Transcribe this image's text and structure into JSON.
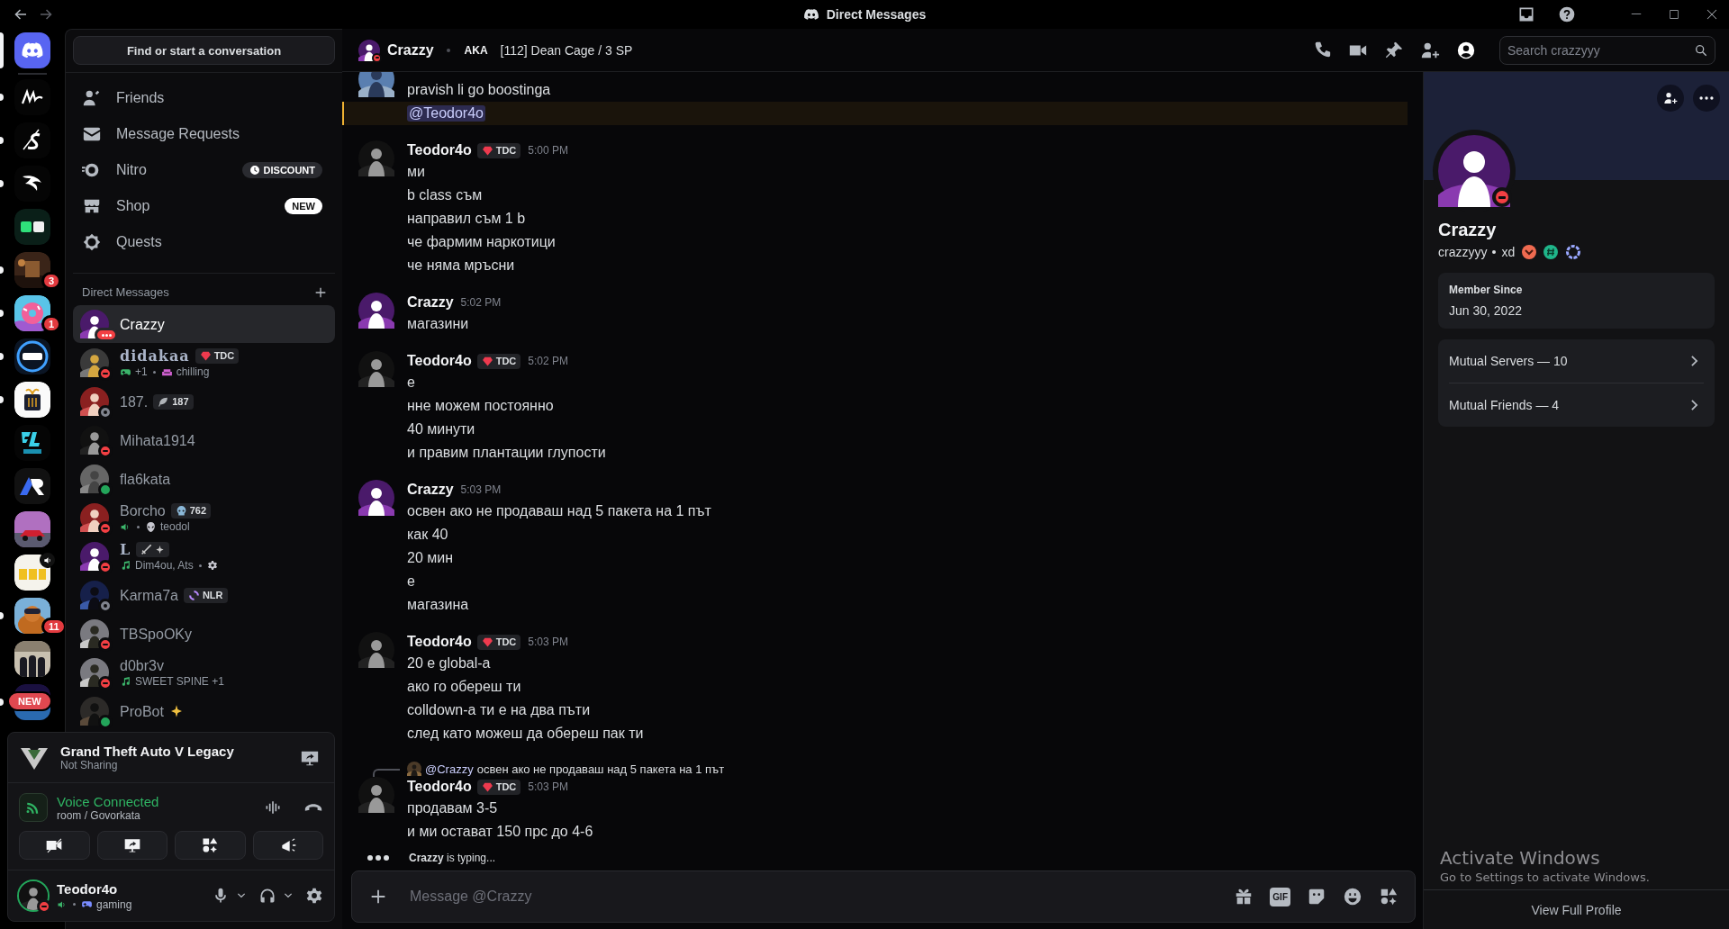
{
  "titlebar": {
    "title": "Direct Messages"
  },
  "servers": [
    {
      "kind": "home",
      "selected": true,
      "unread": false
    },
    {
      "kind": "logo",
      "selected": false,
      "unread": true
    },
    {
      "kind": "logo",
      "selected": false,
      "unread": true
    },
    {
      "kind": "logo",
      "selected": false,
      "unread": true
    },
    {
      "kind": "logo",
      "selected": false,
      "unread": false
    },
    {
      "kind": "picture",
      "selected": false,
      "unread": true,
      "badge": "3"
    },
    {
      "kind": "picture",
      "selected": false,
      "unread": true,
      "badge": "1"
    },
    {
      "kind": "logo",
      "selected": false,
      "unread": true
    },
    {
      "kind": "logo",
      "selected": false,
      "unread": true
    },
    {
      "kind": "logo",
      "selected": false,
      "unread": false
    },
    {
      "kind": "logo",
      "selected": false,
      "unread": false
    },
    {
      "kind": "picture",
      "selected": false,
      "unread": false
    },
    {
      "kind": "logo",
      "selected": false,
      "unread": false,
      "voice": true
    },
    {
      "kind": "picture",
      "selected": false,
      "unread": true,
      "badge": "11"
    },
    {
      "kind": "picture",
      "selected": false,
      "unread": false
    },
    {
      "kind": "picture",
      "selected": false,
      "unread": true,
      "new_label": "NEW"
    }
  ],
  "find_button": "Find or start a conversation",
  "nav": [
    {
      "kind": "friends",
      "label": "Friends",
      "selected": false
    },
    {
      "kind": "mail",
      "label": "Message Requests",
      "selected": false
    },
    {
      "kind": "nitro",
      "label": "Nitro",
      "selected": false,
      "badge": {
        "kind": "discount",
        "text": "DISCOUNT"
      }
    },
    {
      "kind": "shop",
      "label": "Shop",
      "selected": false,
      "badge": {
        "kind": "new",
        "text": "NEW"
      }
    },
    {
      "kind": "quests",
      "label": "Quests",
      "selected": false
    }
  ],
  "dm_heading": "Direct Messages",
  "dms": [
    {
      "name": "Crazzy",
      "presence": {
        "kind": "typing",
        "color": "#f23f43"
      },
      "selected": true
    },
    {
      "name": "didakaa",
      "presence": {
        "kind": "dnd",
        "color": "#f23f43"
      },
      "selected": false,
      "styled_name": true,
      "tag": {
        "kind": "gem",
        "text": "TDC"
      },
      "activity": {
        "kind": "game",
        "text": "+1"
      },
      "custom_status": "chilling"
    },
    {
      "name": "187.",
      "presence": {
        "kind": "offline",
        "color": "#80848e"
      },
      "selected": false,
      "tag": {
        "kind": "leaf",
        "text": "187"
      }
    },
    {
      "name": "Mihata1914",
      "presence": {
        "kind": "dnd",
        "color": "#f23f43"
      },
      "selected": false
    },
    {
      "name": "fla6kata",
      "presence": {
        "kind": "online",
        "color": "#23a55a"
      },
      "selected": false
    },
    {
      "name": "Borcho",
      "presence": {
        "kind": "dnd",
        "color": "#f23f43"
      },
      "selected": false,
      "tag": {
        "kind": "skull",
        "text": "762"
      },
      "activity": {
        "kind": "voice"
      },
      "custom_status": "teodol"
    },
    {
      "name": "L",
      "presence": {
        "kind": "dnd",
        "color": "#f23f43"
      },
      "selected": false,
      "styled_name": true,
      "tag": {
        "kind": "sword"
      },
      "activity": {
        "kind": "music",
        "text": "Dim4ou, Ats"
      },
      "custom_icon": true
    },
    {
      "name": "Karma7a",
      "presence": {
        "kind": "offline",
        "color": "#80848e"
      },
      "selected": false,
      "tag": {
        "kind": "swirl",
        "text": "NLR"
      }
    },
    {
      "name": "TBSpoOKy",
      "presence": {
        "kind": "dnd",
        "color": "#f23f43"
      },
      "selected": false
    },
    {
      "name": "d0br3v",
      "presence": {
        "kind": "dnd",
        "color": "#f23f43"
      },
      "selected": false,
      "activity": {
        "kind": "music",
        "text": "SWEET SPINE +1"
      }
    },
    {
      "name": "ProBot",
      "presence": {
        "kind": "online",
        "color": "#23a55a"
      },
      "selected": false,
      "sparkle": true
    }
  ],
  "panel": {
    "game": {
      "title": "Grand Theft Auto V Legacy",
      "status": "Not Sharing"
    },
    "voice": {
      "label": "Voice Connected",
      "channel": "room / Govorkata"
    },
    "user": {
      "name": "Teodor4o",
      "presence": {
        "kind": "dnd",
        "color": "#f23f43"
      },
      "activity": "gaming"
    }
  },
  "header": {
    "name": "Crazzy",
    "presence": {
      "kind": "dnd",
      "color": "#f23f43"
    },
    "aka_label": "AKA",
    "aka": "[112] Dean Cage / 3 SP",
    "profile_open": true,
    "search_placeholder": "Search crazzyyy"
  },
  "messages": [
    {
      "kind": "cut",
      "lines": [
        {
          "kind": "text",
          "text": "pravish li go boostinga"
        },
        {
          "kind": "mention",
          "text": "@Teodor4o"
        }
      ]
    },
    {
      "kind": "user",
      "author": "Teodor4o",
      "tag": {
        "kind": "gem",
        "text": "TDC"
      },
      "time": "5:00 PM",
      "lines": [
        {
          "kind": "text",
          "text": "ми"
        },
        {
          "kind": "text",
          "text": "b class съм"
        },
        {
          "kind": "text",
          "text": "направил съм 1 b"
        },
        {
          "kind": "text",
          "text": "че фармим наркотици"
        },
        {
          "kind": "text",
          "text": "че няма мръсни"
        }
      ]
    },
    {
      "kind": "user",
      "author": "Crazzy",
      "time": "5:02 PM",
      "lines": [
        {
          "kind": "text",
          "text": "магазини"
        }
      ]
    },
    {
      "kind": "user",
      "author": "Teodor4o",
      "tag": {
        "kind": "gem",
        "text": "TDC"
      },
      "time": "5:02 PM",
      "lines": [
        {
          "kind": "text",
          "text": "е"
        },
        {
          "kind": "text",
          "text": "нне можем постоянно"
        },
        {
          "kind": "text",
          "text": "40 минути"
        },
        {
          "kind": "text",
          "text": "и правим плантации глупости"
        }
      ]
    },
    {
      "kind": "user",
      "author": "Crazzy",
      "time": "5:03 PM",
      "lines": [
        {
          "kind": "text",
          "text": "освен ако не продаваш над 5 пакета на 1 път"
        },
        {
          "kind": "text",
          "text": "как 40"
        },
        {
          "kind": "text",
          "text": "20 мин"
        },
        {
          "kind": "text",
          "text": "е"
        },
        {
          "kind": "text",
          "text": "магазина"
        }
      ]
    },
    {
      "kind": "user",
      "author": "Teodor4o",
      "tag": {
        "kind": "gem",
        "text": "TDC"
      },
      "time": "5:03 PM",
      "lines": [
        {
          "kind": "text",
          "text": "20 е global-a"
        },
        {
          "kind": "text",
          "text": "ако го обереш ти"
        },
        {
          "kind": "text",
          "text": "colldown-a ти е на два пъти"
        },
        {
          "kind": "text",
          "text": "след като можеш да обереш пак ти"
        }
      ]
    },
    {
      "kind": "user",
      "author": "Teodor4o",
      "tag": {
        "kind": "gem",
        "text": "TDC"
      },
      "time": "5:03 PM",
      "reply": {
        "author": "@Crazzy",
        "text": "освен ако не продаваш над 5 пакета на 1 път"
      },
      "lines": [
        {
          "kind": "text",
          "text": "продавам 3-5"
        },
        {
          "kind": "text",
          "text": "и ми остават 150 прс до 4-6"
        }
      ]
    }
  ],
  "typing": "**Crazzy** is typing...",
  "composer": {
    "placeholder": "Message @Crazzy",
    "gif": "GIF"
  },
  "profile": {
    "presence": {
      "kind": "dnd",
      "color": "#f23f43"
    },
    "display_name": "Crazzy",
    "username": "crazzyyy",
    "pronouns": "xd",
    "member_since_label": "Member Since",
    "member_since": "Jun 30, 2022",
    "mutuals": [
      {
        "label": "Mutual Servers — 10"
      },
      {
        "label": "Mutual Friends — 4"
      }
    ],
    "footer": "View Full Profile"
  },
  "activation": {
    "title": "Activate Windows",
    "text": "Go to Settings to activate Windows."
  }
}
